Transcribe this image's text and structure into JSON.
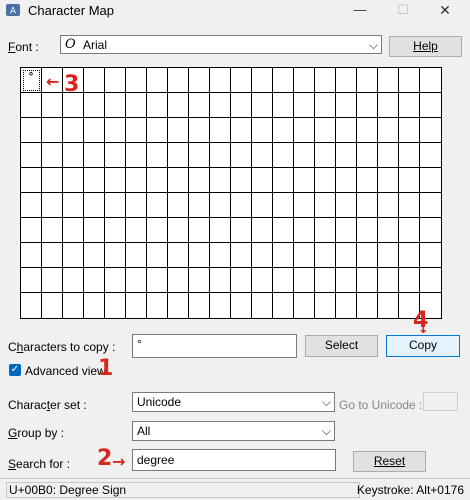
{
  "window": {
    "title": "Character Map",
    "min_glyph": "—",
    "max_glyph": "☐",
    "close_glyph": "✕"
  },
  "font": {
    "label": "Font :",
    "value": "Arial",
    "glyph": "O",
    "help_label": "Help"
  },
  "grid": {
    "columns": 20,
    "rows": 10,
    "cells": [
      "°"
    ]
  },
  "copy": {
    "label": "Characters to copy :",
    "value": "°",
    "select_label": "Select",
    "copy_label": "Copy"
  },
  "advanced": {
    "label": "Advanced view",
    "checked": true,
    "check_glyph": "✓"
  },
  "charset": {
    "label": "Character set :",
    "value": "Unicode",
    "goto_label": "Go to Unicode :"
  },
  "groupby": {
    "label": "Group by :",
    "value": "All"
  },
  "search": {
    "label": "Search for :",
    "value": "degree",
    "reset_label": "Reset"
  },
  "status": {
    "left": "U+00B0: Degree Sign",
    "right": "Keystroke: Alt+0176"
  },
  "annotations": {
    "one": "1",
    "two": "2",
    "three": "3",
    "four": "4",
    "arrow_left": "←",
    "arrow_right": "→",
    "arrow_down": "↓"
  },
  "colors": {
    "annotation": "#d9261c",
    "checkbox": "#0067c0",
    "default_button_border": "#0078d7"
  }
}
